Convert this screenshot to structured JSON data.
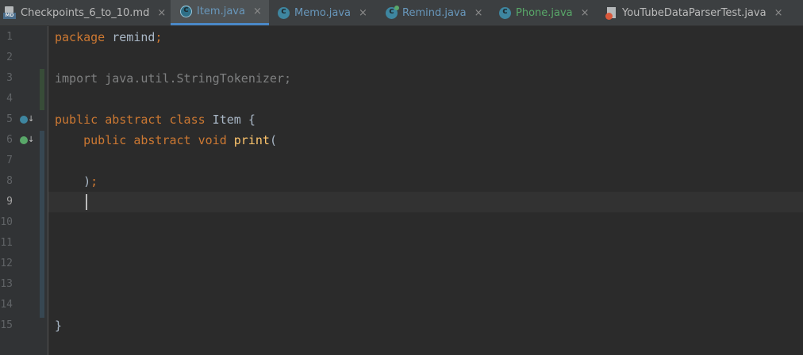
{
  "tabs": [
    {
      "label": "Checkpoints_6_to_10.md",
      "icon": "markdown-file-icon",
      "icon_text": "MD",
      "color": "#bbbbbb",
      "active": false
    },
    {
      "label": "Item.java",
      "icon": "abstract-class-icon",
      "color": "#6897bb",
      "active": true
    },
    {
      "label": "Memo.java",
      "icon": "class-icon",
      "color": "#6897bb",
      "active": false
    },
    {
      "label": "Remind.java",
      "icon": "main-class-icon",
      "color": "#6897bb",
      "active": false
    },
    {
      "label": "Phone.java",
      "icon": "class-icon",
      "color": "#59a869",
      "active": false
    },
    {
      "label": "YouTubeDataParserTest.java",
      "icon": "test-file-icon",
      "color": "#bbbbbb",
      "active": false
    }
  ],
  "close_glyph": "×",
  "gutter": {
    "line_numbers": [
      "1",
      "2",
      "3",
      "4",
      "5",
      "6",
      "7",
      "8",
      "9",
      "10",
      "11",
      "12",
      "13",
      "14",
      "15"
    ],
    "current_line": "9",
    "markers": [
      {
        "line": "5",
        "icon": "implemented-by-icon"
      },
      {
        "line": "6",
        "icon": "implemented-method-icon"
      }
    ]
  },
  "code": {
    "line1": {
      "kw": "package",
      "rest": " remind",
      "punct": ";"
    },
    "line3": {
      "text": "import java.util.StringTokenizer;"
    },
    "line5": {
      "kw": "public abstract class",
      "rest": " Item {"
    },
    "line6": {
      "indent": "    ",
      "kw": "public abstract void",
      "fn": " print",
      "rest": "("
    },
    "line8": {
      "indent": "    ",
      "rest": ")",
      "punct": ";"
    },
    "line15": {
      "rest": "}"
    }
  },
  "colors": {
    "keyword": "#cc7832",
    "identifier": "#a9b7c6",
    "unused_import": "#7f8081",
    "method": "#ffc66d",
    "active_tab_underline": "#4a88c7",
    "vcs_added": "#384c38",
    "vcs_modified": "#374752"
  }
}
